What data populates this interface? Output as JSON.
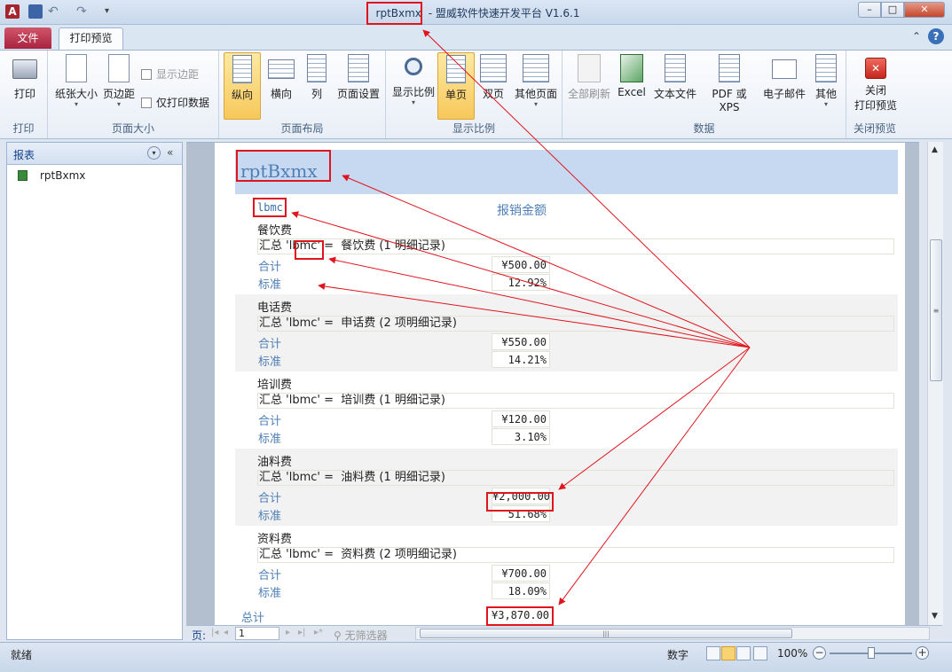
{
  "window": {
    "app_icon": "A",
    "doc_name": "rptBxmx",
    "separator": " - ",
    "app_name": "盟威软件快速开发平台 V1.6.1",
    "min": "–",
    "max": "□",
    "close": "✕"
  },
  "tabs": {
    "file": "文件",
    "print_preview": "打印预览"
  },
  "ribbon": {
    "print": {
      "label": "打印",
      "group": "打印"
    },
    "page_size": {
      "paper_size": "纸张大小",
      "margins": "页边距",
      "show_margins": "显示边距",
      "print_data_only": "仅打印数据",
      "group": "页面大小"
    },
    "page_layout": {
      "portrait": "纵向",
      "landscape": "横向",
      "columns": "列",
      "page_setup": "页面设置",
      "group": "页面布局"
    },
    "zoom": {
      "zoom": "显示比例",
      "one_page": "单页",
      "two_pages": "双页",
      "more_pages": "其他页面",
      "group": "显示比例"
    },
    "data": {
      "refresh_all": "全部刷新",
      "excel": "Excel",
      "text_file": "文本文件",
      "pdf_xps": "PDF 或 XPS",
      "email": "电子邮件",
      "more": "其他",
      "group": "数据"
    },
    "close": {
      "label": "关闭\n打印预览",
      "label_l1": "关闭",
      "label_l2": "打印预览",
      "group": "关闭预览"
    }
  },
  "nav": {
    "title": "报表",
    "items": [
      {
        "label": "rptBxmx"
      }
    ]
  },
  "report": {
    "title": "rptBxmx",
    "col_lbmc": "lbmc",
    "col_amount": "报销金额",
    "total_label": "合计",
    "std_label": "标准",
    "groups": [
      {
        "name": "餐饮费",
        "summary_pre": "汇总 '",
        "summary_field": "lbmc",
        "summary_post": "' =  餐饮费 (1 明细记录)",
        "total": "¥500.00",
        "std": "12.92%"
      },
      {
        "name": "电话费",
        "summary": "汇总 'lbmc' =  申话费 (2 项明细记录)",
        "total": "¥550.00",
        "std": "14.21%"
      },
      {
        "name": "培训费",
        "summary": "汇总 'lbmc' =  培训费 (1 明细记录)",
        "total": "¥120.00",
        "std": "3.10%"
      },
      {
        "name": "油料费",
        "summary": "汇总 'lbmc' =  油料费 (1 明细记录)",
        "total": "¥2,000.00",
        "std": "51.68%"
      },
      {
        "name": "资料费",
        "summary": "汇总 'lbmc' =  资料费 (2 项明细记录)",
        "total": "¥700.00",
        "std": "18.09%"
      }
    ],
    "grand_total_label": "总计",
    "grand_total": "¥3,870.00"
  },
  "record_nav": {
    "label": "页:",
    "page": "1",
    "filter": "无筛选器"
  },
  "status": {
    "ready": "就绪",
    "numlock": "数字",
    "zoom": "100%"
  },
  "colors": {
    "annotation": "#e0141d",
    "accent": "#4e7fb6",
    "header_band": "#c6d9f0"
  }
}
